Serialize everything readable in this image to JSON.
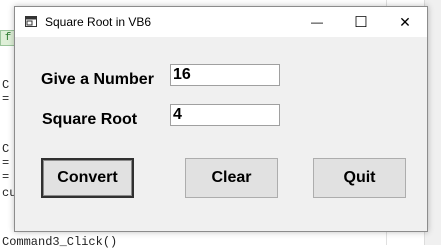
{
  "window": {
    "title": "Square Root in VB6",
    "minimize_glyph": "—",
    "maximize_glyph": "☐",
    "close_glyph": "✕",
    "icon": "app-window-icon"
  },
  "form": {
    "number_label": "Give a Number",
    "number_value": "16",
    "root_label": "Square Root",
    "root_value": "4"
  },
  "buttons": {
    "convert": "Convert",
    "clear": "Clear",
    "quit": "Quit"
  },
  "background_code": {
    "gutter_marker": "f",
    "fragments": [
      "C",
      "=",
      "C",
      "=",
      "=",
      "cu"
    ],
    "bottom_line": "Command3_Click()"
  }
}
